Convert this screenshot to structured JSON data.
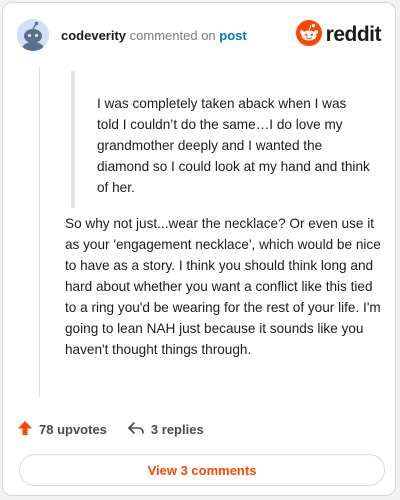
{
  "header": {
    "username": "codeverity",
    "commented_on": "commented on",
    "post_link": "post",
    "brand_name": "reddit"
  },
  "comment": {
    "quote": "I was completely taken aback when I was told I couldn’t do the same…I do love my grandmother deeply and I wanted the diamond so I could look at my hand and think of her.",
    "body": "So why not just...wear the necklace? Or even use it as your 'engagement necklace', which would be nice to have as a story. I think you should think long and hard about whether you want a conflict like this tied to a ring you'd be wearing for the rest of your life. I'm going to lean NAH just because it sounds like you haven't thought things through."
  },
  "actions": {
    "upvotes": "78 upvotes",
    "replies": "3 replies"
  },
  "footer": {
    "view_comments": "View 3 comments"
  },
  "icons": {
    "avatar": "reddit-snoo-avatar-icon",
    "brand": "reddit-logo-icon",
    "upvote": "upvote-arrow-icon",
    "reply": "reply-arrow-icon"
  },
  "colors": {
    "accent": "#ff4500",
    "link": "#0079d3",
    "avatar_bg": "#cfe0f7"
  }
}
